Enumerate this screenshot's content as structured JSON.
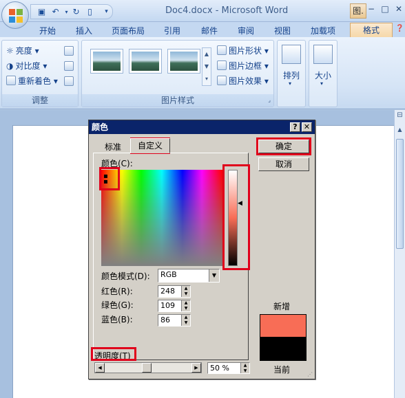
{
  "app": {
    "window_title": "Doc4.docx - Microsoft Word",
    "contextual_tab_label": "图.",
    "win_controls": [
      "−",
      "□",
      "✕"
    ]
  },
  "tabs": [
    "开始",
    "插入",
    "页面布局",
    "引用",
    "邮件",
    "审阅",
    "视图",
    "加载项",
    "格式"
  ],
  "ribbon": {
    "adjust": {
      "brightness": "亮度",
      "contrast": "对比度",
      "recolor": "重新着色",
      "label": "调整"
    },
    "picture_styles": {
      "shape": "图片形状",
      "border": "图片边框",
      "effects": "图片效果",
      "label": "图片样式"
    },
    "arrange": "排列",
    "size": "大小"
  },
  "dialog": {
    "title": "颜色",
    "help_btn": "?",
    "close_btn": "✕",
    "tabs": {
      "standard": "标准",
      "custom": "自定义"
    },
    "colors_label": "颜色(C):",
    "color_model_label": "颜色模式(D):",
    "color_model_value": "RGB",
    "red_label": "红色(R):",
    "red_value": "248",
    "green_label": "绿色(G):",
    "green_value": "109",
    "blue_label": "蓝色(B):",
    "blue_value": "86",
    "ok": "确定",
    "cancel": "取消",
    "new_label": "新增",
    "current_label": "当前",
    "transparency_label": "透明度(T)",
    "transparency_value": "50 %",
    "colors": {
      "new": "#f86d56",
      "current": "#000000"
    }
  }
}
